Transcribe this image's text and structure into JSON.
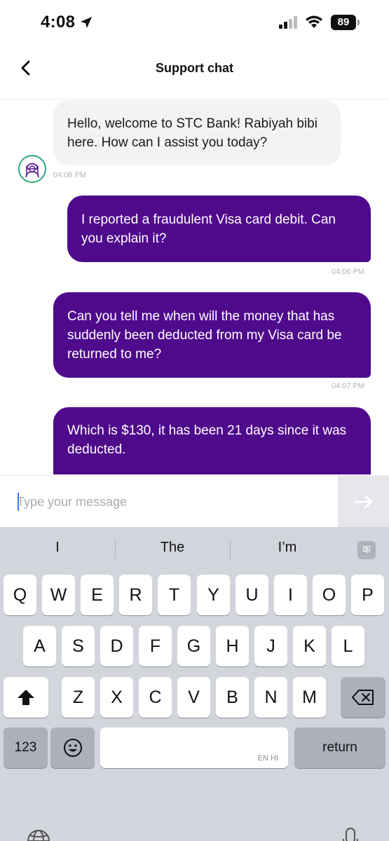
{
  "status_bar": {
    "time": "4:08",
    "battery": "89"
  },
  "header": {
    "title": "Support chat"
  },
  "messages": [
    {
      "from": "agent",
      "text": "Hello, welcome to STC Bank! Rabiyah bibi here. How can I assist you today?",
      "time": "04:06 PM"
    },
    {
      "from": "user",
      "text": "I reported a fraudulent Visa card debit. Can you explain it?",
      "time": "04:06 PM"
    },
    {
      "from": "user",
      "text": "Can you tell me when will the money that has suddenly been deducted from my Visa card be returned to me?",
      "time": "04:07 PM"
    },
    {
      "from": "user",
      "text": "Which is $130, it has been 21 days since it was deducted.",
      "time": ""
    }
  ],
  "composer": {
    "placeholder": "Type your message"
  },
  "keyboard": {
    "suggestions": [
      "I",
      "The",
      "I’m"
    ],
    "hindi_key": "क",
    "row1": [
      "Q",
      "W",
      "E",
      "R",
      "T",
      "Y",
      "U",
      "I",
      "O",
      "P"
    ],
    "row2": [
      "A",
      "S",
      "D",
      "F",
      "G",
      "H",
      "J",
      "K",
      "L"
    ],
    "row3": [
      "Z",
      "X",
      "C",
      "V",
      "B",
      "N",
      "M"
    ],
    "numbers_label": "123",
    "space_language": "EN HI",
    "return_label": "return"
  },
  "colors": {
    "outgoing_bubble": "#4f0a8c",
    "incoming_bubble": "#f1f3f5",
    "avatar_ring": "#2fa87b",
    "keyboard_bg": "#d2d5db"
  },
  "icons": [
    "location-arrow-icon",
    "cellular-signal-icon",
    "wifi-icon",
    "chevron-left-icon",
    "agent-avatar-icon",
    "send-arrow-icon",
    "shift-icon",
    "delete-icon",
    "emoji-icon",
    "globe-icon",
    "microphone-icon"
  ]
}
